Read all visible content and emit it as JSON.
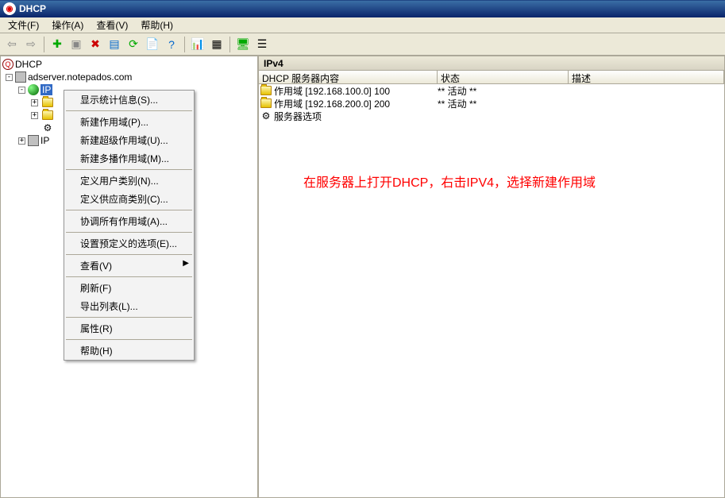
{
  "title": "DHCP",
  "menubar": {
    "file": "文件(F)",
    "action": "操作(A)",
    "view": "查看(V)",
    "help": "帮助(H)"
  },
  "tree": {
    "root": "DHCP",
    "server": "adserver.notepados.com",
    "ipv4_sel": "IP",
    "ipv6": "IP"
  },
  "context_menu": {
    "items": [
      "显示统计信息(S)...",
      "新建作用域(P)...",
      "新建超级作用域(U)...",
      "新建多播作用域(M)...",
      "定义用户类别(N)...",
      "定义供应商类别(C)...",
      "协调所有作用域(A)...",
      "设置预定义的选项(E)...",
      "查看(V)",
      "刷新(F)",
      "导出列表(L)...",
      "属性(R)",
      "帮助(H)"
    ]
  },
  "right": {
    "header": "IPv4",
    "columns": {
      "c1": "DHCP 服务器内容",
      "c2": "状态",
      "c3": "描述"
    },
    "rows": [
      {
        "name": "作用域 [192.168.100.0] 100",
        "status": "** 活动 **",
        "type": "folder"
      },
      {
        "name": "作用域 [192.168.200.0] 200",
        "status": "** 活动 **",
        "type": "folder"
      },
      {
        "name": "服务器选项",
        "status": "",
        "type": "gear"
      }
    ]
  },
  "annotation": "在服务器上打开DHCP，右击IPV4，选择新建作用域"
}
